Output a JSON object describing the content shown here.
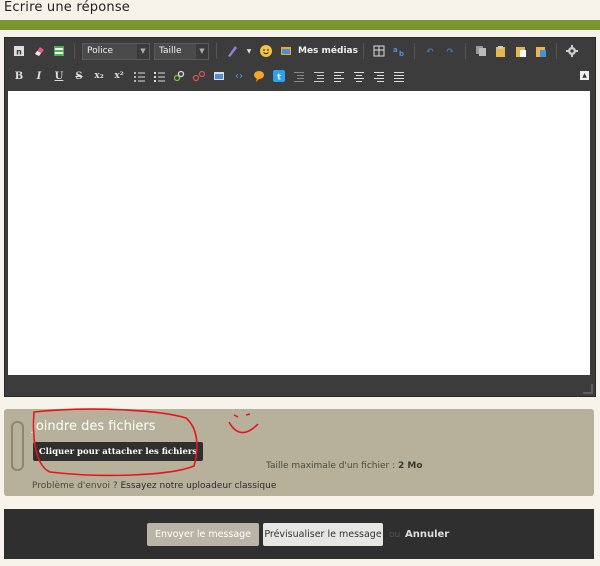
{
  "header": {
    "title": "Ecrire une réponse"
  },
  "toolbar": {
    "font_select": "Police",
    "size_select": "Taille",
    "media_label": "Mes médias",
    "format_buttons": [
      "B",
      "I",
      "U",
      "S",
      "x₂",
      "x²"
    ]
  },
  "attachments": {
    "title": "Joindre des fichiers",
    "button_label": "Cliquer pour attacher les fichiers",
    "max_size_label": "Taille maximale d'un fichier :",
    "max_size_value": "2 Mo",
    "problem_text": "Problème d'envoi ?",
    "problem_link": "Essayez notre uploadeur classique"
  },
  "footer": {
    "send_label": "Envoyer le message",
    "preview_label": "Prévisualiser le message",
    "or_label": "ou",
    "cancel_label": "Annuler"
  },
  "colors": {
    "accent_green": "#7a9632",
    "editor_dark": "#3c3c3c",
    "attach_panel": "#b7b09a",
    "annotation_red": "#e8161a"
  }
}
